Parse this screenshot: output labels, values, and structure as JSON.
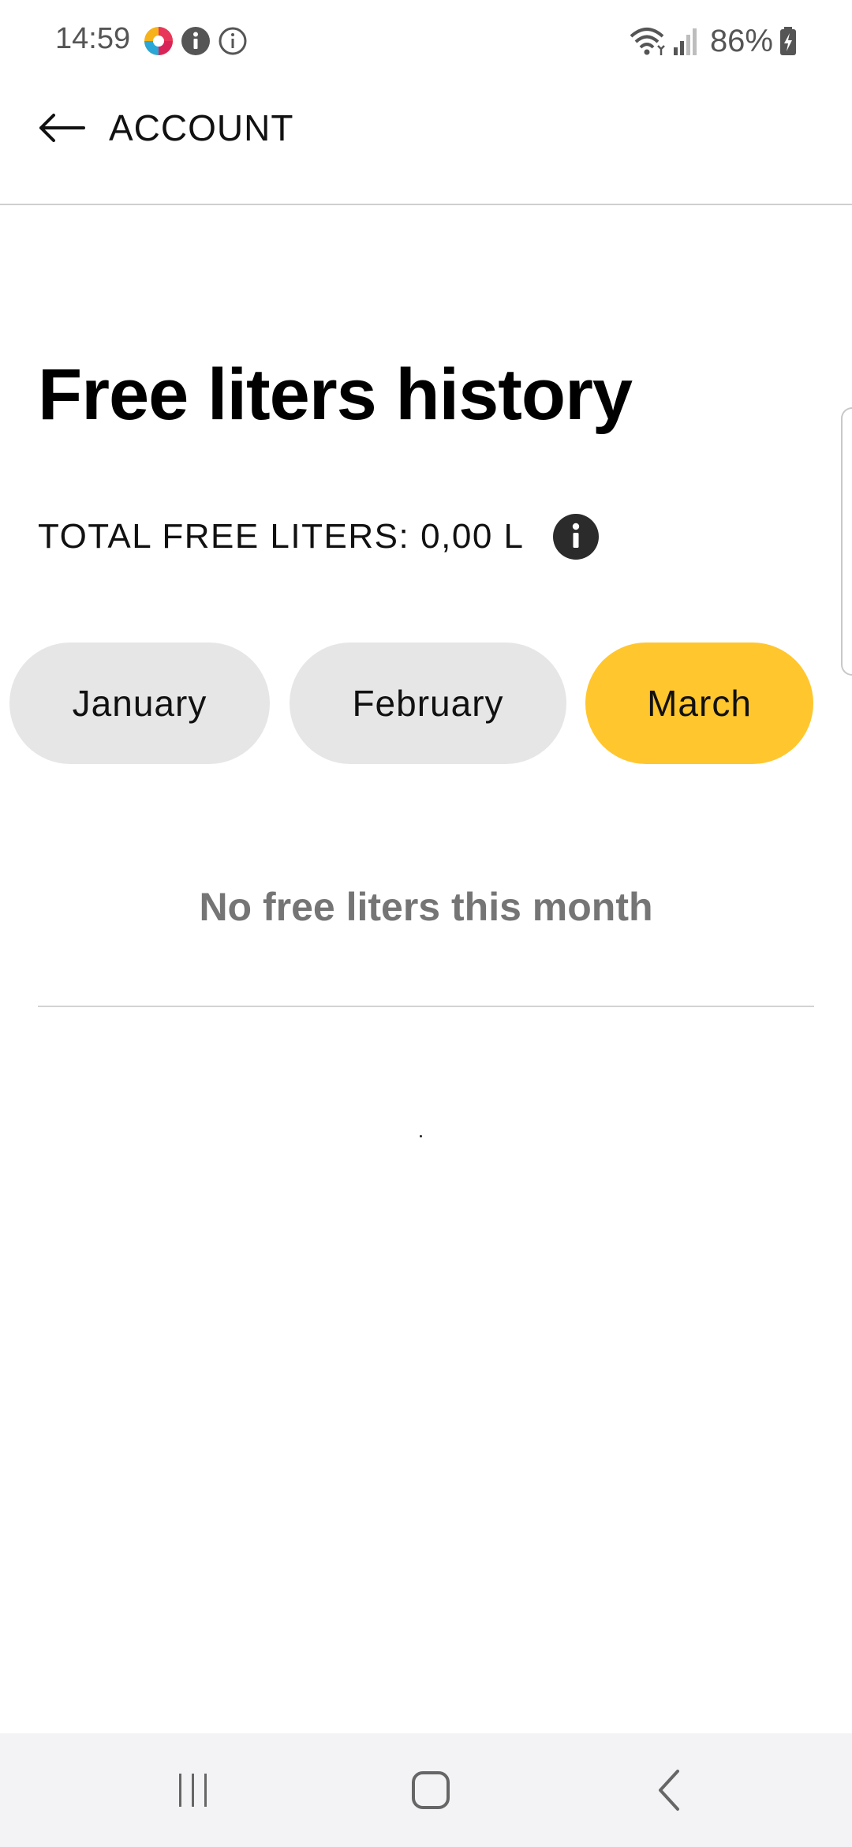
{
  "status_bar": {
    "time": "14:59",
    "battery": "86%",
    "icons": [
      "app-colorful-icon",
      "info-filled-icon",
      "info-outline-icon",
      "wifi-icon",
      "signal-icon",
      "battery-charging-icon"
    ]
  },
  "app_bar": {
    "back_label": "ACCOUNT",
    "back_icon": "arrow-left-icon"
  },
  "page": {
    "title": "Free liters history",
    "total_label": "TOTAL FREE LITERS:",
    "total_value": "0,00 L",
    "info_icon": "info-icon"
  },
  "months": [
    {
      "label": "January",
      "selected": false
    },
    {
      "label": "February",
      "selected": false
    },
    {
      "label": "March",
      "selected": true
    }
  ],
  "empty_state": {
    "message": "No free liters this month"
  },
  "colors": {
    "accent": "#ffc62e",
    "pill_inactive": "#e6e6e6",
    "muted_text": "#757575"
  },
  "nav_bar": {
    "buttons": [
      "recent-apps-icon",
      "home-icon",
      "back-icon"
    ]
  }
}
